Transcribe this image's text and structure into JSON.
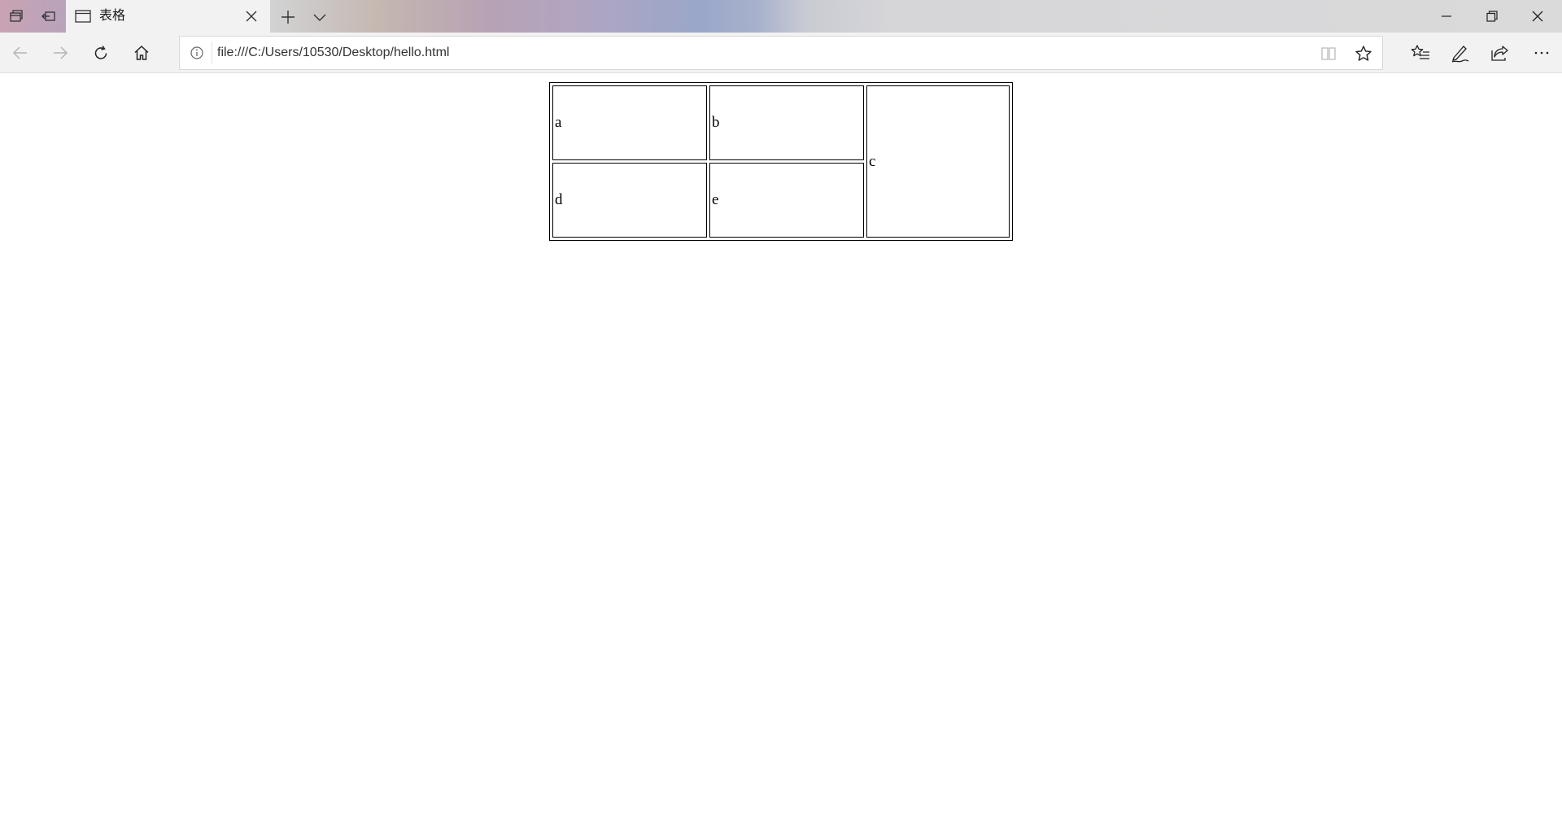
{
  "tab": {
    "title": "表格"
  },
  "address_bar": {
    "url": "file:///C:/Users/10530/Desktop/hello.html"
  },
  "table": {
    "row1": {
      "a": "a",
      "b": "b",
      "c": "c"
    },
    "row2": {
      "d": "d",
      "e": "e"
    }
  },
  "colors": {
    "chrome_bg": "#f2f2f2",
    "page_bg": "#ffffff",
    "border": "#000000"
  }
}
